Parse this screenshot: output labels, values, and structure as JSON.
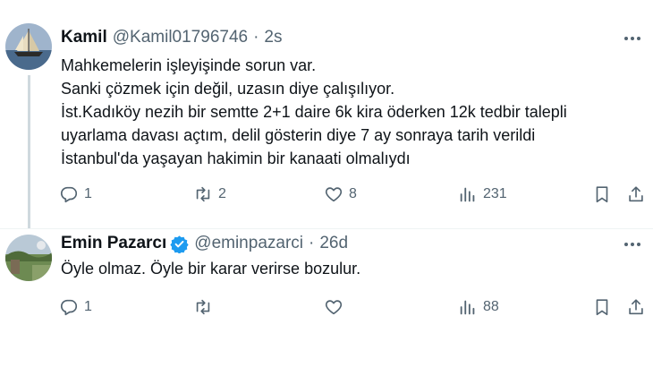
{
  "tweets": [
    {
      "author": {
        "name": "Kamil",
        "handle": "@Kamil01796746",
        "time": "2s"
      },
      "lines": [
        "Mahkemelerin işleyişinde sorun var.",
        "Sanki çözmek için değil, uzasın diye çalışılıyor.",
        "İst.Kadıköy nezih bir semtte 2+1 daire 6k kira öderken 12k tedbir talepli",
        "uyarlama davası açtım, delil gösterin diye 7 ay sonraya tarih verildi",
        "İstanbul'da yaşayan hakimin bir kanaati olmalıydı"
      ],
      "stats": {
        "replies": "1",
        "reposts": "2",
        "likes": "8",
        "views": "231"
      }
    },
    {
      "author": {
        "name": "Emin Pazarcı",
        "handle": "@eminpazarci",
        "time": "26d",
        "verified": true
      },
      "lines": [
        "Öyle olmaz. Öyle bir karar verirse bozulur."
      ],
      "stats": {
        "replies": "1",
        "reposts": "",
        "likes": "",
        "views": "88"
      }
    }
  ],
  "separator": "·",
  "icons": {
    "avatar_1": "sailboat-avatar",
    "avatar_2": "landscape-avatar",
    "verified": "verified-badge-icon",
    "more": "more-icon",
    "reply": "reply-icon",
    "repost": "repost-icon",
    "like": "heart-icon",
    "views": "views-icon",
    "bookmark": "bookmark-icon",
    "share": "share-icon"
  },
  "colors": {
    "text": "#0f1419",
    "secondary": "#536471",
    "verified": "#1d9bf0",
    "line": "#cfd9de"
  }
}
